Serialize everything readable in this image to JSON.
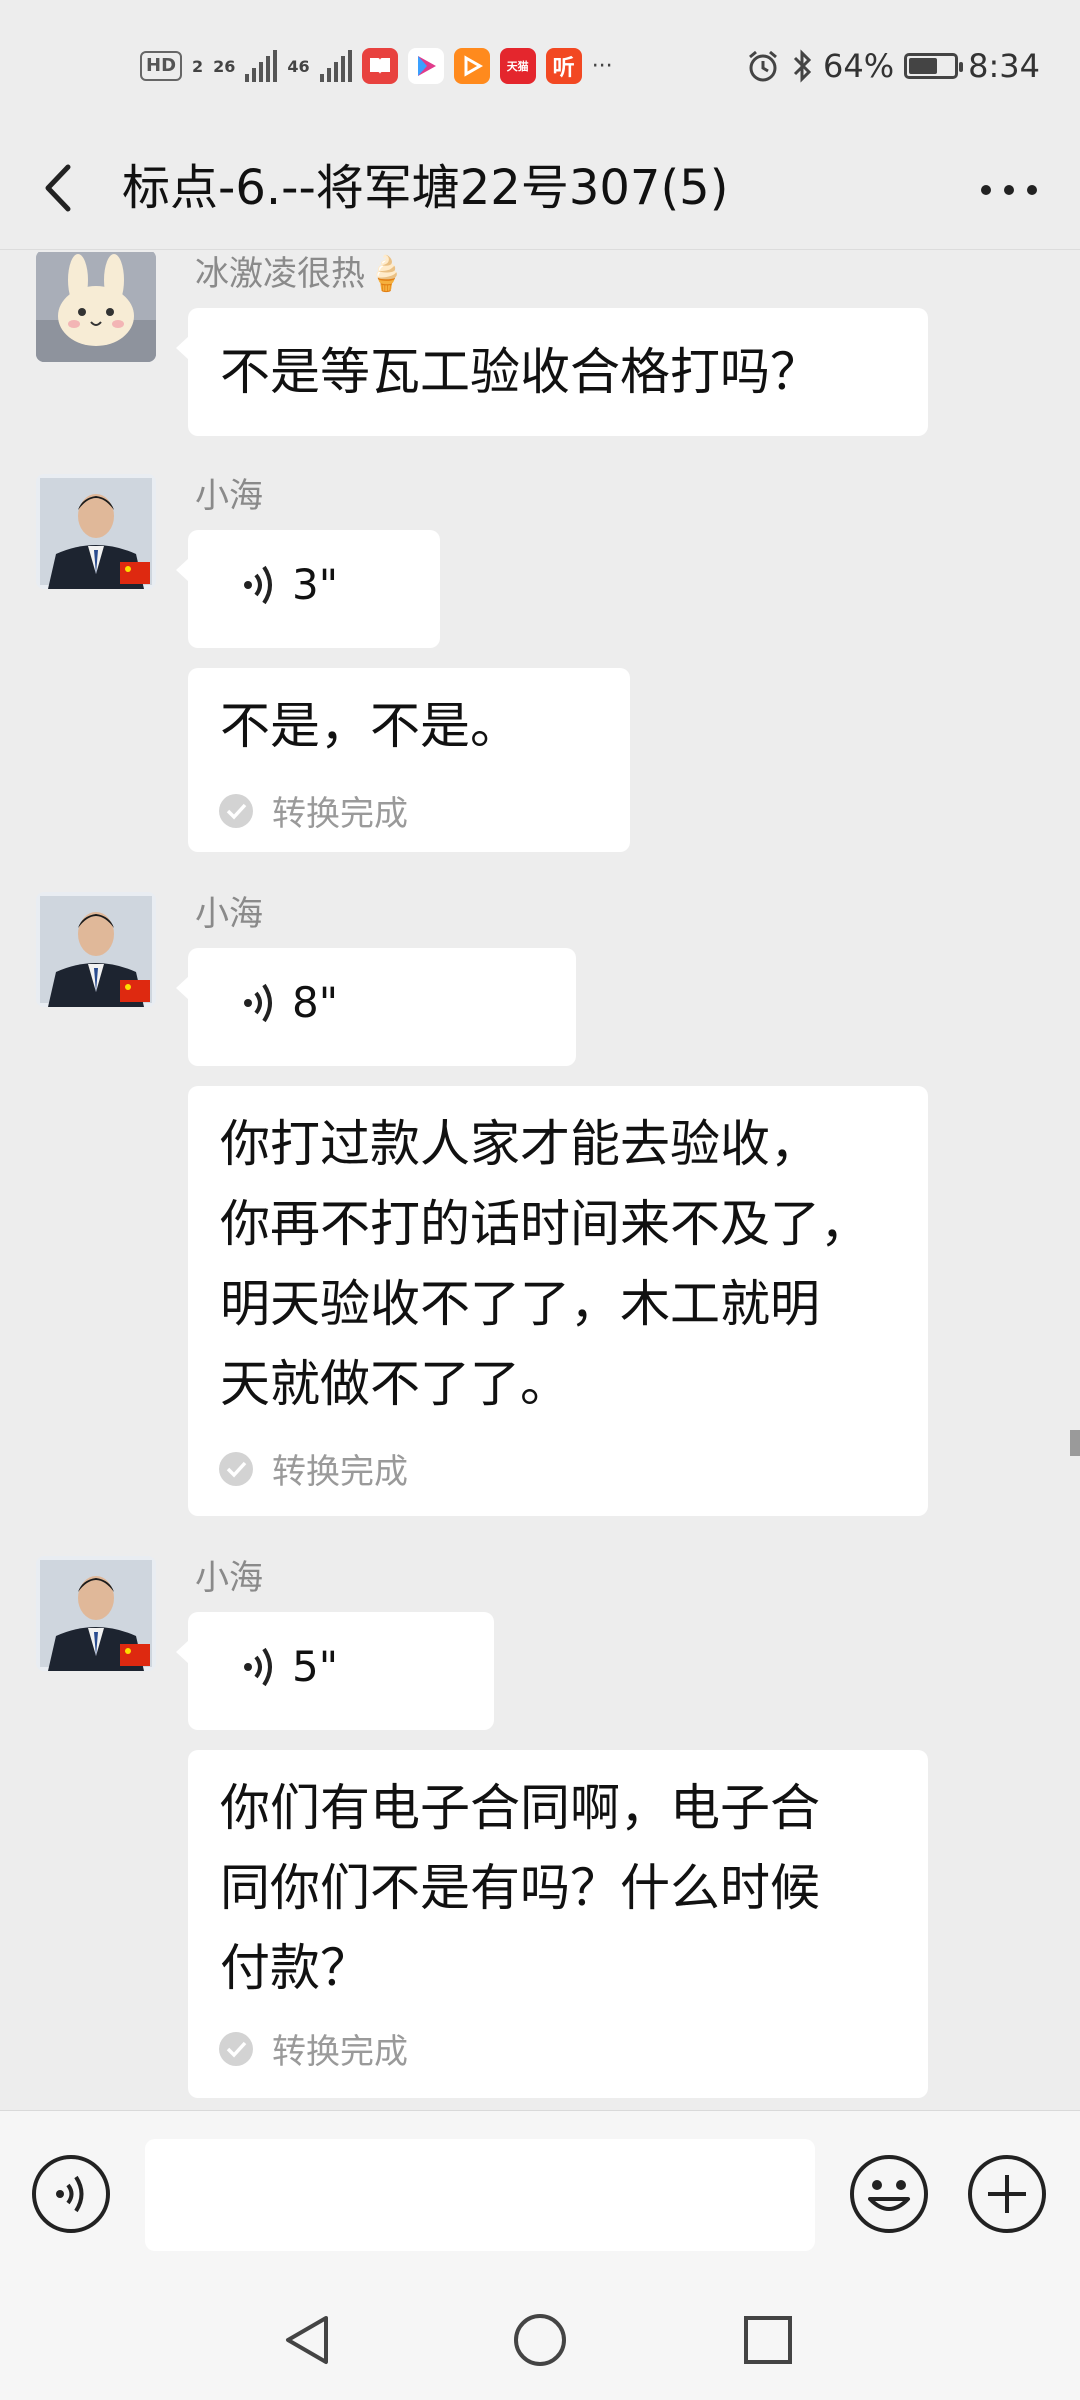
{
  "status_bar": {
    "hd_badge": "HD",
    "hd_sub": "2",
    "net1": "26",
    "net2": "46",
    "app_icons": [
      "book-app-icon",
      "video-app-icon",
      "play-app-icon",
      "tmall-app-icon",
      "ting-app-icon"
    ],
    "tmall_label": "天猫",
    "ting_label": "听",
    "more": "···",
    "battery_percent": "64%",
    "battery_level": 0.64,
    "time": "8:34"
  },
  "header": {
    "title": "标点-6.--将军塘22号307(5)"
  },
  "messages": [
    {
      "sender": "冰激凌很热🍦",
      "type": "text",
      "text": "不是等瓦工验收合格打吗？"
    },
    {
      "sender": "小海",
      "type": "voice",
      "duration": "3\"",
      "transcript": "不是，不是。",
      "status": "转换完成"
    },
    {
      "sender": "小海",
      "type": "voice",
      "duration": "8\"",
      "transcript": "你打过款人家才能去验收，\n你再不打的话时间来不及了，\n明天验收不了了，木工就明\n天就做不了了。",
      "status": "转换完成"
    },
    {
      "sender": "小海",
      "type": "voice",
      "duration": "5\"",
      "transcript": "你们有电子合同啊，电子合\n同你们不是有吗？什么时候\n付款？",
      "status": "转换完成"
    }
  ],
  "input": {
    "value": "",
    "placeholder": ""
  },
  "colors": {
    "background": "#ededed",
    "bubble": "#ffffff",
    "secondary_text": "#8a8a8a"
  }
}
